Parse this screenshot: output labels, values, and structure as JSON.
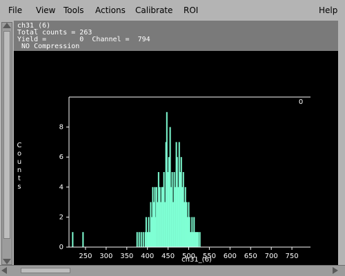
{
  "menu": {
    "items": [
      "File",
      "View",
      "Tools",
      "Actions",
      "Calibrate",
      "ROI"
    ],
    "help": "Help"
  },
  "info": {
    "name": "ch31_(6)",
    "total": "Total counts = 263",
    "yield": "Yield =        0  Channel =  794",
    "compression": " NO Compression"
  },
  "colors": {
    "bars": "#7fffd4",
    "plot_bg": "#000000",
    "info_bg": "#7a7a7a",
    "frame": "#b4b4b4"
  },
  "chart_data": {
    "type": "bar",
    "xlabel": "ch31_(6)",
    "ylabel": "Counts",
    "xlim": [
      210,
      795
    ],
    "ylim": [
      0,
      10
    ],
    "xticks": [
      250,
      300,
      350,
      400,
      450,
      500,
      550,
      600,
      650,
      700,
      750
    ],
    "yticks": [
      0,
      2,
      4,
      6,
      8
    ],
    "marker_label": "0",
    "x": [
      219,
      244,
      375,
      380,
      385,
      390,
      395,
      397,
      400,
      403,
      405,
      408,
      410,
      413,
      415,
      418,
      420,
      422,
      425,
      427,
      430,
      432,
      435,
      437,
      440,
      442,
      445,
      447,
      450,
      452,
      455,
      457,
      460,
      462,
      465,
      467,
      470,
      472,
      475,
      477,
      480,
      482,
      485,
      487,
      490,
      492,
      495,
      497,
      500,
      502,
      505,
      508,
      510,
      513,
      515,
      518,
      520,
      523,
      527
    ],
    "y": [
      1,
      1,
      1,
      1,
      1,
      1,
      1,
      2,
      1,
      2,
      1,
      3,
      2,
      4,
      3,
      4,
      2,
      4,
      3,
      5,
      4,
      3,
      4,
      4,
      5,
      3,
      7,
      9,
      5,
      6,
      8,
      4,
      5,
      3,
      5,
      4,
      7,
      6,
      4,
      7,
      5,
      6,
      4,
      5,
      3,
      4,
      3,
      2,
      3,
      2,
      1,
      2,
      1,
      2,
      1,
      1,
      1,
      1,
      1
    ]
  }
}
